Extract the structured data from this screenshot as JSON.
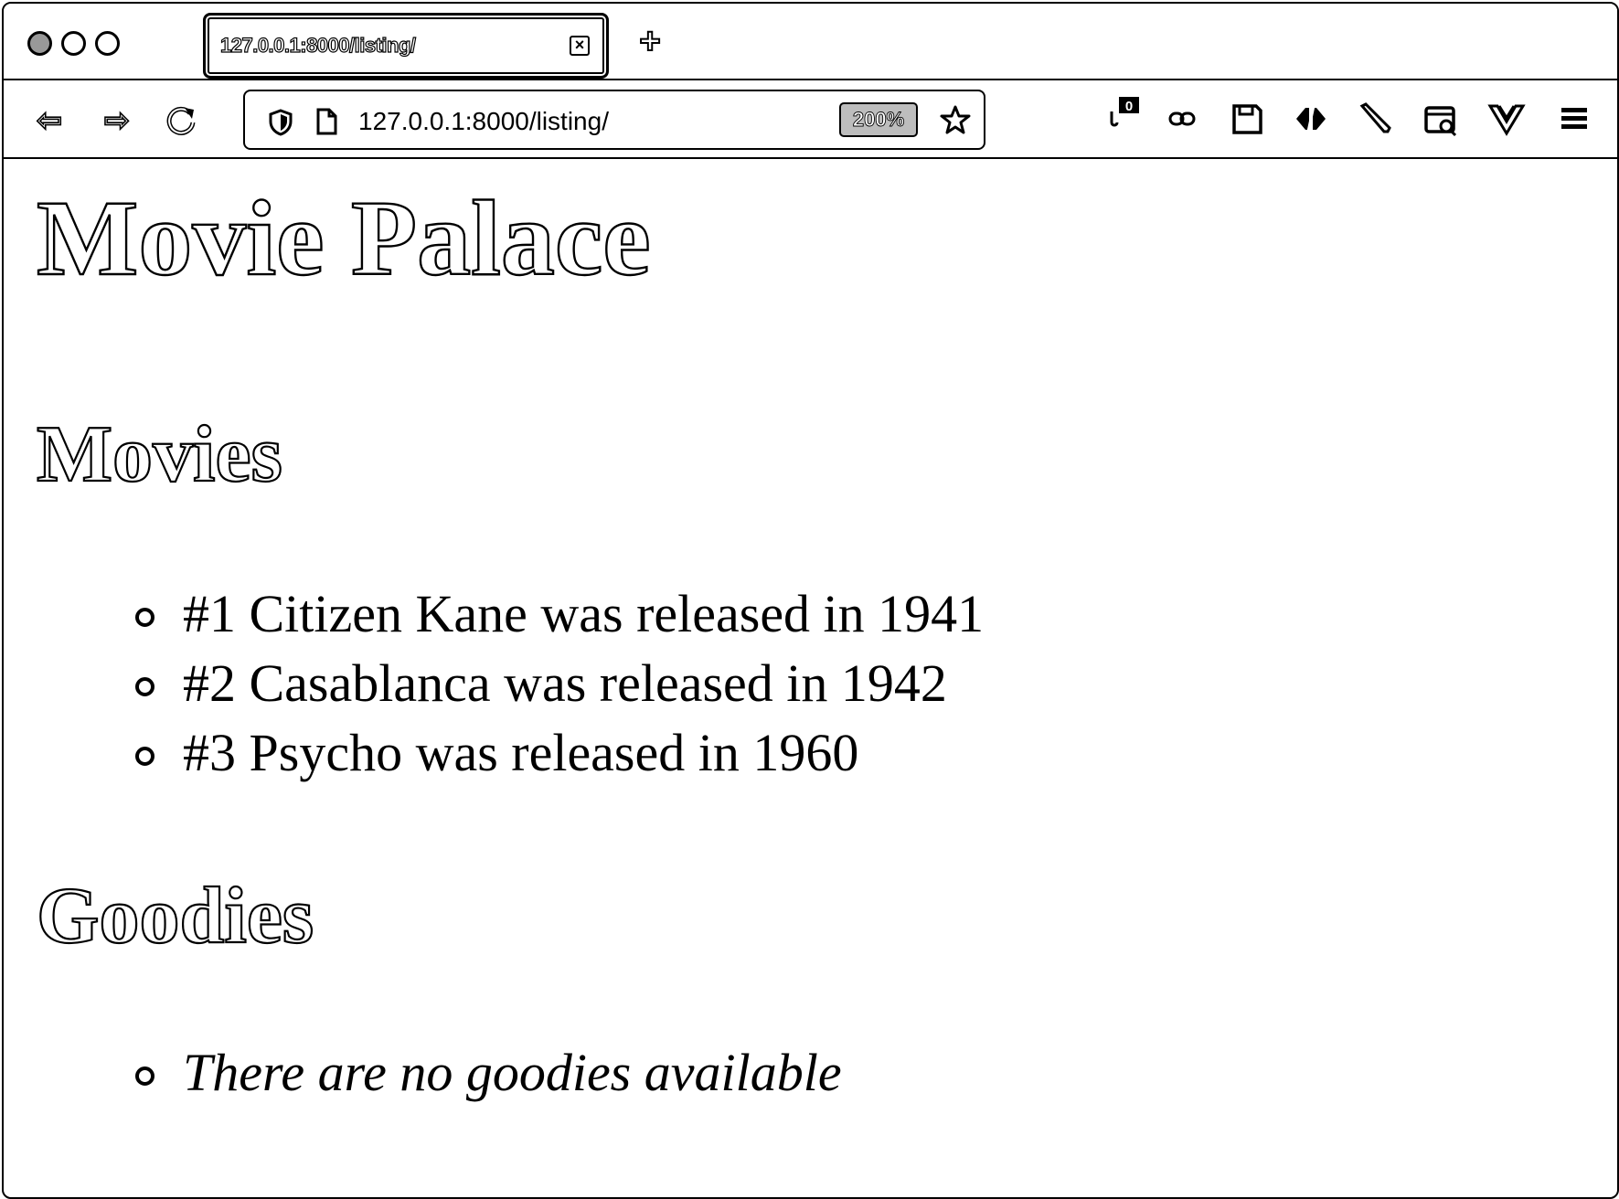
{
  "browser": {
    "tab_title": "127.0.0.1:8000/listing/",
    "url": "127.0.0.1:8000/listing/",
    "zoom": "200%",
    "toolbar_icons": [
      "extension-counter-icon",
      "link-icon",
      "save-icon",
      "code-icon",
      "pencil-icon",
      "screenshot-icon",
      "vue-icon",
      "menu-icon"
    ],
    "extension_badge": "0"
  },
  "page": {
    "title": "Movie Palace",
    "movies_heading": "Movies",
    "movies": [
      "#1 Citizen Kane was released in 1941",
      "#2 Casablanca was released in 1942",
      "#3 Psycho was released in 1960"
    ],
    "goodies_heading": "Goodies",
    "goodies_empty": "There are no goodies available"
  }
}
